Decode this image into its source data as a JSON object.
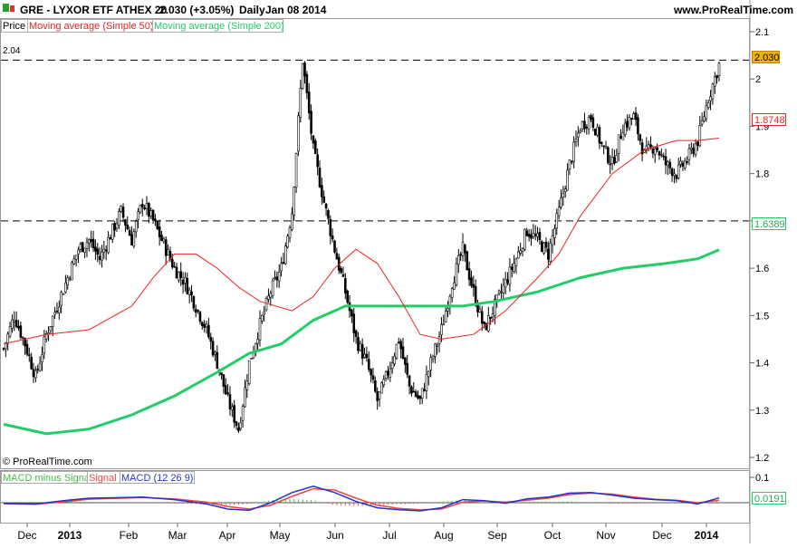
{
  "header": {
    "title": "GRE - LYXOR ETF ATHEX 20",
    "price": "2.030 (+3.05%)",
    "period": "Daily",
    "date": "Jan 08 2014",
    "brand": "www.ProRealTime.com"
  },
  "legend": {
    "price": "Price",
    "ma50": "Moving average (Simple 50)",
    "ma200": "Moving average (Simple 200)"
  },
  "badges": {
    "last": "2.030",
    "ma50": "1.8748",
    "ma200": "1.6389",
    "macd": "0.0191",
    "level_label": "2.04"
  },
  "copyright": "© ProRealTime.com",
  "macd_legend": {
    "hist": "MACD minus Signal",
    "signal": "Signal",
    "macd": "MACD (12 26 9)"
  },
  "colors": {
    "ma50": "#ee2222",
    "ma200": "#22cc66",
    "macd": "#2233cc",
    "signal": "#ee4444",
    "hist": "#44bb44",
    "badge_last": "#f0b400"
  },
  "chart_data": {
    "type": "candlestick",
    "price_axis": {
      "ylim": [
        1.2,
        2.1
      ],
      "ticks": [
        "2.1",
        "2",
        "1.9",
        "1.8",
        "1.7",
        "1.6",
        "1.5",
        "1.4",
        "1.3",
        "1.2"
      ]
    },
    "macd_axis": {
      "ylim": [
        -0.05,
        0.1
      ],
      "ticks": [
        "0.1"
      ]
    },
    "x_ticks": [
      "Dec",
      "2013",
      "Feb",
      "Mar",
      "Apr",
      "May",
      "Jun",
      "Jul",
      "Aug",
      "Sep",
      "Oct",
      "Nov",
      "Dec",
      "2014"
    ],
    "reference_lines": [
      2.04,
      1.7
    ],
    "close_series": [
      [
        0,
        1.43
      ],
      [
        5,
        1.5
      ],
      [
        10,
        1.44
      ],
      [
        15,
        1.37
      ],
      [
        20,
        1.46
      ],
      [
        25,
        1.52
      ],
      [
        30,
        1.58
      ],
      [
        35,
        1.64
      ],
      [
        40,
        1.66
      ],
      [
        45,
        1.62
      ],
      [
        50,
        1.67
      ],
      [
        55,
        1.72
      ],
      [
        60,
        1.66
      ],
      [
        65,
        1.74
      ],
      [
        70,
        1.7
      ],
      [
        75,
        1.65
      ],
      [
        80,
        1.6
      ],
      [
        85,
        1.57
      ],
      [
        90,
        1.52
      ],
      [
        95,
        1.47
      ],
      [
        100,
        1.4
      ],
      [
        105,
        1.32
      ],
      [
        110,
        1.26
      ],
      [
        115,
        1.4
      ],
      [
        120,
        1.48
      ],
      [
        125,
        1.55
      ],
      [
        130,
        1.6
      ],
      [
        135,
        1.72
      ],
      [
        140,
        2.04
      ],
      [
        145,
        1.85
      ],
      [
        150,
        1.74
      ],
      [
        155,
        1.64
      ],
      [
        160,
        1.55
      ],
      [
        165,
        1.45
      ],
      [
        170,
        1.4
      ],
      [
        175,
        1.32
      ],
      [
        180,
        1.38
      ],
      [
        185,
        1.45
      ],
      [
        190,
        1.35
      ],
      [
        195,
        1.32
      ],
      [
        200,
        1.4
      ],
      [
        205,
        1.47
      ],
      [
        210,
        1.57
      ],
      [
        215,
        1.64
      ],
      [
        220,
        1.55
      ],
      [
        225,
        1.47
      ],
      [
        230,
        1.52
      ],
      [
        235,
        1.57
      ],
      [
        240,
        1.62
      ],
      [
        245,
        1.68
      ],
      [
        250,
        1.66
      ],
      [
        255,
        1.63
      ],
      [
        260,
        1.72
      ],
      [
        265,
        1.82
      ],
      [
        270,
        1.9
      ],
      [
        275,
        1.92
      ],
      [
        280,
        1.86
      ],
      [
        285,
        1.82
      ],
      [
        290,
        1.9
      ],
      [
        295,
        1.92
      ],
      [
        300,
        1.84
      ],
      [
        305,
        1.86
      ],
      [
        310,
        1.82
      ],
      [
        315,
        1.8
      ],
      [
        320,
        1.83
      ],
      [
        325,
        1.87
      ],
      [
        330,
        1.96
      ],
      [
        335,
        2.03
      ]
    ],
    "ma50": [
      [
        0,
        1.44
      ],
      [
        20,
        1.46
      ],
      [
        40,
        1.47
      ],
      [
        60,
        1.52
      ],
      [
        70,
        1.58
      ],
      [
        80,
        1.63
      ],
      [
        90,
        1.63
      ],
      [
        100,
        1.6
      ],
      [
        110,
        1.56
      ],
      [
        120,
        1.53
      ],
      [
        135,
        1.51
      ],
      [
        145,
        1.54
      ],
      [
        155,
        1.6
      ],
      [
        165,
        1.64
      ],
      [
        175,
        1.61
      ],
      [
        185,
        1.54
      ],
      [
        195,
        1.46
      ],
      [
        205,
        1.45
      ],
      [
        220,
        1.46
      ],
      [
        235,
        1.51
      ],
      [
        250,
        1.58
      ],
      [
        260,
        1.63
      ],
      [
        270,
        1.71
      ],
      [
        285,
        1.8
      ],
      [
        300,
        1.85
      ],
      [
        315,
        1.87
      ],
      [
        325,
        1.87
      ],
      [
        335,
        1.875
      ]
    ],
    "ma200": [
      [
        0,
        1.27
      ],
      [
        20,
        1.25
      ],
      [
        40,
        1.26
      ],
      [
        60,
        1.29
      ],
      [
        80,
        1.33
      ],
      [
        100,
        1.38
      ],
      [
        115,
        1.42
      ],
      [
        130,
        1.44
      ],
      [
        145,
        1.49
      ],
      [
        160,
        1.52
      ],
      [
        175,
        1.52
      ],
      [
        195,
        1.52
      ],
      [
        215,
        1.52
      ],
      [
        230,
        1.53
      ],
      [
        250,
        1.55
      ],
      [
        270,
        1.58
      ],
      [
        290,
        1.6
      ],
      [
        310,
        1.61
      ],
      [
        325,
        1.62
      ],
      [
        335,
        1.639
      ]
    ],
    "macd": [
      [
        0,
        -0.003
      ],
      [
        15,
        -0.005
      ],
      [
        30,
        0.01
      ],
      [
        40,
        0.018
      ],
      [
        55,
        0.02
      ],
      [
        65,
        0.022
      ],
      [
        80,
        0.012
      ],
      [
        95,
        -0.005
      ],
      [
        105,
        -0.025
      ],
      [
        115,
        -0.03
      ],
      [
        125,
        0.0
      ],
      [
        135,
        0.04
      ],
      [
        145,
        0.065
      ],
      [
        155,
        0.04
      ],
      [
        165,
        0.005
      ],
      [
        175,
        -0.02
      ],
      [
        185,
        -0.028
      ],
      [
        195,
        -0.032
      ],
      [
        205,
        -0.02
      ],
      [
        215,
        0.012
      ],
      [
        225,
        0.008
      ],
      [
        235,
        -0.002
      ],
      [
        245,
        0.015
      ],
      [
        255,
        0.022
      ],
      [
        265,
        0.038
      ],
      [
        275,
        0.04
      ],
      [
        285,
        0.03
      ],
      [
        295,
        0.018
      ],
      [
        305,
        0.012
      ],
      [
        315,
        0.008
      ],
      [
        325,
        -0.005
      ],
      [
        335,
        0.0191
      ]
    ],
    "signal": [
      [
        0,
        -0.004
      ],
      [
        15,
        -0.006
      ],
      [
        30,
        0.005
      ],
      [
        40,
        0.014
      ],
      [
        55,
        0.018
      ],
      [
        65,
        0.02
      ],
      [
        80,
        0.015
      ],
      [
        95,
        0.002
      ],
      [
        105,
        -0.015
      ],
      [
        115,
        -0.025
      ],
      [
        125,
        -0.01
      ],
      [
        135,
        0.025
      ],
      [
        145,
        0.055
      ],
      [
        155,
        0.05
      ],
      [
        165,
        0.018
      ],
      [
        175,
        -0.01
      ],
      [
        185,
        -0.022
      ],
      [
        195,
        -0.028
      ],
      [
        205,
        -0.025
      ],
      [
        215,
        0.002
      ],
      [
        225,
        0.007
      ],
      [
        235,
        0.002
      ],
      [
        245,
        0.01
      ],
      [
        255,
        0.018
      ],
      [
        265,
        0.032
      ],
      [
        275,
        0.038
      ],
      [
        285,
        0.034
      ],
      [
        295,
        0.022
      ],
      [
        305,
        0.014
      ],
      [
        315,
        0.01
      ],
      [
        325,
        0.0
      ],
      [
        335,
        0.01
      ]
    ]
  }
}
